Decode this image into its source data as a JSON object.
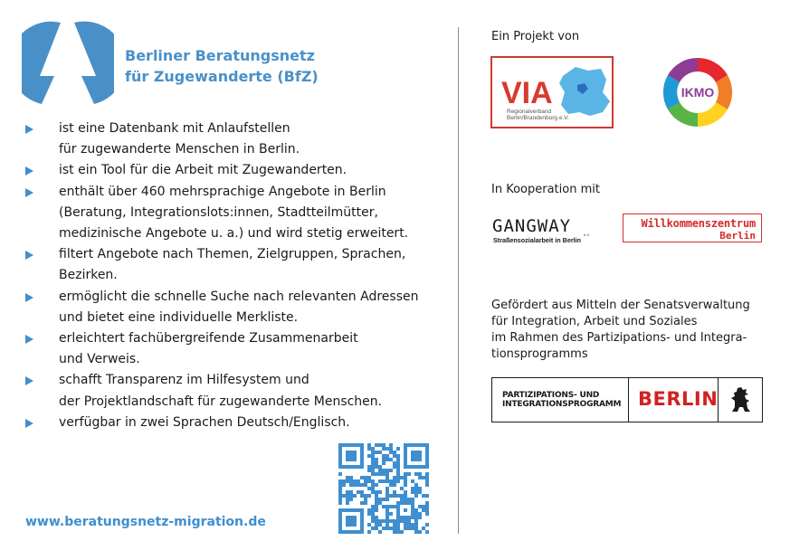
{
  "org": {
    "name_line1": "Berliner Beratungsnetz",
    "name_line2": "für Zugewanderte (BfZ)"
  },
  "features": [
    [
      "ist eine Datenbank mit Anlaufstellen",
      "für zugewanderte Menschen in Berlin."
    ],
    [
      "ist ein Tool für die Arbeit mit Zugewanderten."
    ],
    [
      "enthält über 460 mehrsprachige Angebote in Berlin",
      "(Beratung, Integrationslots:innen, Stadtteilmütter,",
      "medizinische Angebote u. a.) und wird stetig erweitert."
    ],
    [
      "filtert Angebote nach Themen, Zielgruppen, Sprachen,",
      "Bezirken."
    ],
    [
      "ermöglicht die schnelle Suche nach relevanten Adressen",
      "und bietet eine individuelle Merkliste."
    ],
    [
      "erleichtert fachübergreifende Zusammenarbeit",
      "und Verweis."
    ],
    [
      "schafft Transparenz im Hilfesystem und",
      "der Projektlandschaft für zugewanderte Menschen."
    ],
    [
      "verfügbar in zwei Sprachen Deutsch/Englisch."
    ]
  ],
  "website": "www.beratungsnetz-migration.de",
  "project": {
    "heading": "Ein Projekt von",
    "via": {
      "short": "VIA",
      "line1": "Regionalverband",
      "line2": "Berlin/Brandenburg e.V."
    },
    "ikmo": {
      "label": "IKMO"
    }
  },
  "cooperation": {
    "heading": "In Kooperation mit",
    "gangway": {
      "name": "GANGWAY",
      "suffix": "e.V.",
      "tagline": "Straßensozialarbeit in Berlin"
    },
    "willkommen": {
      "line1": "Willkommenszentrum",
      "line2": "Berlin"
    }
  },
  "funding": {
    "lines": [
      "Gefördert aus Mitteln der Senatsverwaltung",
      "für Integration, Arbeit und Soziales",
      "im Rahmen des Partizipations- und Integra-",
      "tionsprogramms"
    ],
    "program_line1": "PARTIZIPATIONS- UND",
    "program_line2": "INTEGRATIONSPROGRAMM",
    "berlin": "BERLIN"
  },
  "colors": {
    "brand_blue": "#4a90c8",
    "bullet_blue": "#3f8fd0",
    "berlin_red": "#d42020"
  }
}
